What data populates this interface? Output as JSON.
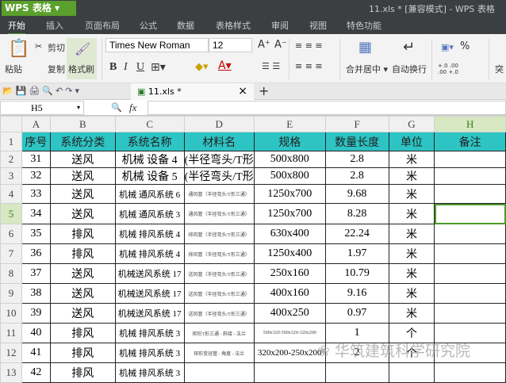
{
  "app": {
    "menu_label": "WPS 表格",
    "window_title": "11.xls * [兼容模式] - WPS 表格"
  },
  "tabs": [
    "开始",
    "插入",
    "页面布局",
    "公式",
    "数据",
    "表格样式",
    "审阅",
    "视图",
    "特色功能"
  ],
  "ribbon": {
    "paste": "粘贴",
    "cut": "剪切",
    "copy": "复制",
    "format_painter": "格式刷",
    "font_name": "Times New Roman",
    "font_size": "12",
    "merge_center": "合并居中",
    "wrap_text": "自动换行",
    "percent": "%",
    "decimal_inc": "+.0 .00",
    "decimal_dec": ".00 +.0",
    "more": "突"
  },
  "file_tab": {
    "name": "11.xls *",
    "close": "×",
    "add": "+"
  },
  "formula_bar": {
    "cell_ref": "H5",
    "fx": "fx",
    "value": ""
  },
  "columns": [
    "A",
    "B",
    "C",
    "D",
    "E",
    "F",
    "G",
    "H"
  ],
  "header_row": [
    "序号",
    "系统分类",
    "系统名称",
    "材料名",
    "规格",
    "数量长度",
    "单位",
    "备注"
  ],
  "rows": [
    [
      "31",
      "送风",
      "机械 设备 4",
      "(半径弯头/T形",
      "500x800",
      "2.8",
      "米",
      ""
    ],
    [
      "32",
      "送风",
      "机械 设备 5",
      "(半径弯头/T形",
      "500x800",
      "2.8",
      "米",
      ""
    ],
    [
      "33",
      "送风",
      "机械 通风系统 6",
      "通风管（半径弯头/T形三通）",
      "1250x700",
      "9.68",
      "米",
      ""
    ],
    [
      "34",
      "送风",
      "机械 通风系统 3",
      "通风管（半径弯头/T形三通）",
      "1250x700",
      "8.28",
      "米",
      ""
    ],
    [
      "35",
      "排风",
      "机械 排风系统 4",
      "排风管（半径弯头/T形三通）",
      "630x400",
      "22.24",
      "米",
      ""
    ],
    [
      "36",
      "排风",
      "机械 排风系统 4",
      "排风管（半径弯头/T形三通）",
      "1250x400",
      "1.97",
      "米",
      ""
    ],
    [
      "37",
      "送风",
      "机械送风系统 17",
      "送风管（半径弯头/T形三通）",
      "250x160",
      "10.79",
      "米",
      ""
    ],
    [
      "38",
      "送风",
      "机械送风系统 17",
      "送风管（半径弯头/T形三通）",
      "400x160",
      "9.16",
      "米",
      ""
    ],
    [
      "39",
      "送风",
      "机械送风系统 17",
      "送风管（半径弯头/T形三通）",
      "400x250",
      "0.97",
      "米",
      ""
    ],
    [
      "40",
      "排风",
      "机械 排风系统 3",
      "矩形T形三通 - 斜接 - 法兰",
      "500x320-500x320-320x200",
      "1",
      "个",
      ""
    ],
    [
      "41",
      "排风",
      "机械 排风系统 3",
      "矩形变径管 - 角度 - 法兰",
      "320x200-250x200",
      "2",
      "个",
      ""
    ],
    [
      "42",
      "排风",
      "机械 排风系统 3",
      "",
      "",
      "",
      "",
      ""
    ]
  ],
  "watermark": "华筑建筑科学研究院"
}
